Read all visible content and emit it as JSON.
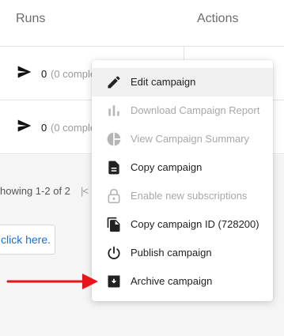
{
  "table": {
    "headers": {
      "runs": "Runs",
      "actions": "Actions"
    },
    "rows": [
      {
        "count": "0",
        "sub": "(0 comple"
      },
      {
        "count": "0",
        "sub": "(0 comple"
      }
    ]
  },
  "pagination": {
    "text": "howing 1-2 of 2",
    "prev": "|<"
  },
  "click_button": {
    "label": "click here."
  },
  "menu": {
    "items": [
      {
        "label": "Edit campaign",
        "icon": "pencil-icon",
        "enabled": true
      },
      {
        "label": "Download Campaign Report",
        "icon": "bar-chart-icon",
        "enabled": false
      },
      {
        "label": "View Campaign Summary",
        "icon": "pie-chart-icon",
        "enabled": false
      },
      {
        "label": "Copy campaign",
        "icon": "document-icon",
        "enabled": true
      },
      {
        "label": "Enable new subscriptions",
        "icon": "lock-icon",
        "enabled": false
      },
      {
        "label": "Copy campaign ID (728200)",
        "icon": "copy-icon",
        "enabled": true
      },
      {
        "label": "Publish campaign",
        "icon": "power-icon",
        "enabled": true
      },
      {
        "label": "Archive campaign",
        "icon": "archive-icon",
        "enabled": true
      }
    ]
  },
  "colors": {
    "annotation_arrow": "#e8141b",
    "link": "#1a6fd1",
    "disabled": "#a8a8a8"
  }
}
